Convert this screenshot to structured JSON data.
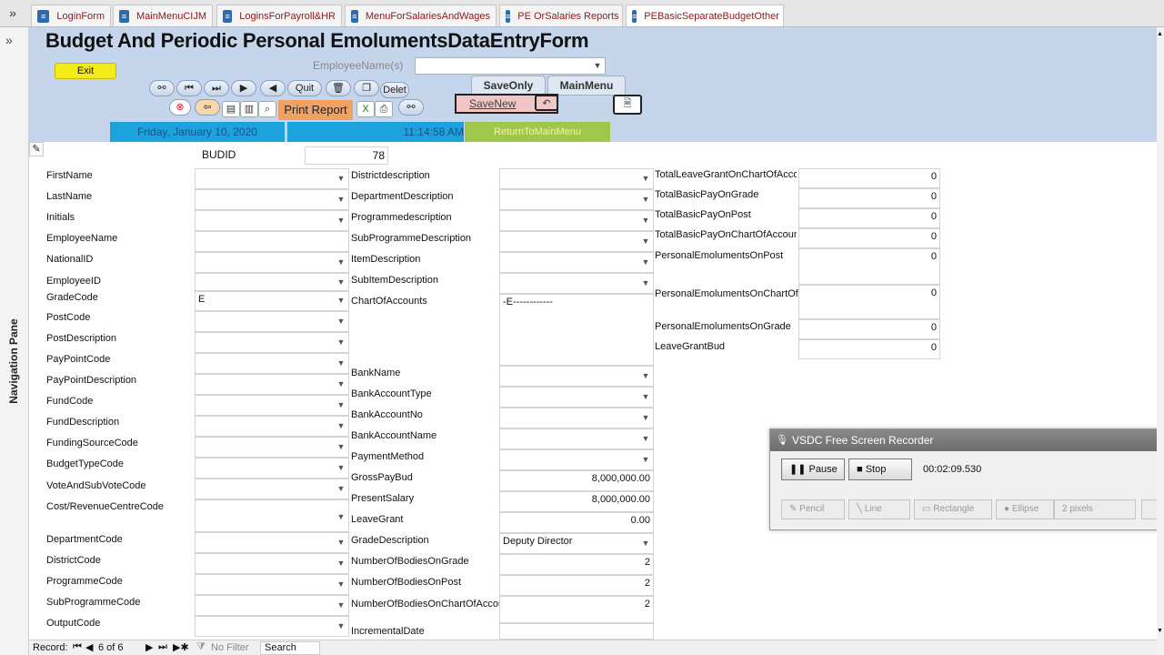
{
  "tabs": [
    {
      "label": "LoginForm",
      "active": false
    },
    {
      "label": "MainMenuCIJM",
      "active": false
    },
    {
      "label": "LoginsForPayroll&HR",
      "active": false
    },
    {
      "label": "MenuForSalariesAndWages",
      "active": false
    },
    {
      "label": "PE OrSalaries Reports",
      "active": false
    },
    {
      "label": "PEBasicSeparateBudgetOther",
      "active": true
    }
  ],
  "nav_pane": {
    "label": "Navigation Pane",
    "toggle": "»"
  },
  "header": {
    "title": "Budget And Periodic Personal EmolumentsDataEntryForm",
    "exit_label": "Exit",
    "employee_label": "EmployeeName(s)",
    "employee_value": "",
    "quit_label": "Quit",
    "delete_label": "Delet",
    "save_only_label": "SaveOnly",
    "main_menu_label": "MainMenu",
    "save_new_label": "SaveNew",
    "print_report_label": "Print Report",
    "date": "Friday, January 10, 2020",
    "time": "11:14:58 AM",
    "return_label": "ReturnToMainMenu"
  },
  "budid": {
    "label": "BUDID",
    "value": "78"
  },
  "col1": [
    {
      "label": "FirstName",
      "value": ""
    },
    {
      "label": "LastName",
      "value": ""
    },
    {
      "label": "Initials",
      "value": ""
    },
    {
      "label": "EmployeeName",
      "value": ""
    },
    {
      "label": "NationalID",
      "value": ""
    },
    {
      "label": "EmployeeID",
      "value": ""
    },
    {
      "label": "GradeCode",
      "value": "E"
    },
    {
      "label": "PostCode",
      "value": ""
    },
    {
      "label": "PostDescription",
      "value": ""
    },
    {
      "label": "PayPointCode",
      "value": ""
    },
    {
      "label": "PayPointDescription",
      "value": ""
    },
    {
      "label": "FundCode",
      "value": ""
    },
    {
      "label": "FundDescription",
      "value": ""
    },
    {
      "label": "FundingSourceCode",
      "value": ""
    },
    {
      "label": "BudgetTypeCode",
      "value": ""
    },
    {
      "label": "VoteAndSubVoteCode",
      "value": ""
    },
    {
      "label": "Cost/RevenueCentreCode",
      "value": ""
    },
    {
      "label": "DepartmentCode",
      "value": ""
    },
    {
      "label": "DistrictCode",
      "value": ""
    },
    {
      "label": "ProgrammeCode",
      "value": ""
    },
    {
      "label": "SubProgrammeCode",
      "value": ""
    },
    {
      "label": "OutputCode",
      "value": ""
    }
  ],
  "col2": [
    {
      "label": "Districtdescription",
      "value": ""
    },
    {
      "label": "DepartmentDescription",
      "value": ""
    },
    {
      "label": "Programmedescription",
      "value": ""
    },
    {
      "label": "SubProgrammeDescription",
      "value": ""
    },
    {
      "label": "ItemDescription",
      "value": ""
    },
    {
      "label": "SubItemDescription",
      "value": ""
    },
    {
      "label": "ChartOfAccounts",
      "value": "-E------------"
    },
    {
      "label": "BankName",
      "value": ""
    },
    {
      "label": "BankAccountType",
      "value": ""
    },
    {
      "label": "BankAccountNo",
      "value": ""
    },
    {
      "label": "BankAccountName",
      "value": ""
    },
    {
      "label": "PaymentMethod",
      "value": ""
    },
    {
      "label": "GrossPayBud",
      "value": "8,000,000.00"
    },
    {
      "label": "PresentSalary",
      "value": "8,000,000.00"
    },
    {
      "label": "LeaveGrant",
      "value": "0.00"
    },
    {
      "label": "GradeDescription",
      "value": "Deputy Director"
    },
    {
      "label": "NumberOfBodiesOnGrade",
      "value": "2"
    },
    {
      "label": "NumberOfBodiesOnPost",
      "value": "2"
    },
    {
      "label": "NumberOfBodiesOnChartOfAccounts",
      "value": "2"
    },
    {
      "label": "IncrementalDate",
      "value": ""
    }
  ],
  "col3": [
    {
      "label": "TotalLeaveGrantOnChartOfAccounts",
      "value": "0"
    },
    {
      "label": "TotalBasicPayOnGrade",
      "value": "0"
    },
    {
      "label": "TotalBasicPayOnPost",
      "value": "0"
    },
    {
      "label": "TotalBasicPayOnChartOfAccounts",
      "value": "0"
    },
    {
      "label": "PersonalEmolumentsOnPost",
      "value": "0"
    },
    {
      "label": "PersonalEmolumentsOnChartOfAccounts",
      "value": "0"
    },
    {
      "label": "PersonalEmolumentsOnGrade",
      "value": "0"
    },
    {
      "label": "LeaveGrantBud",
      "value": "0"
    }
  ],
  "recorder": {
    "title": "VSDC Free Screen Recorder",
    "pause": "Pause",
    "stop": "Stop",
    "time": "00:02:09.530",
    "pencil": "Pencil",
    "line": "Line",
    "rectangle": "Rectangle",
    "ellipse": "Ellipse",
    "size": "2 pixels"
  },
  "status": {
    "record_label": "Record:",
    "position": "6 of 6",
    "filter": "No Filter",
    "search": "Search"
  }
}
